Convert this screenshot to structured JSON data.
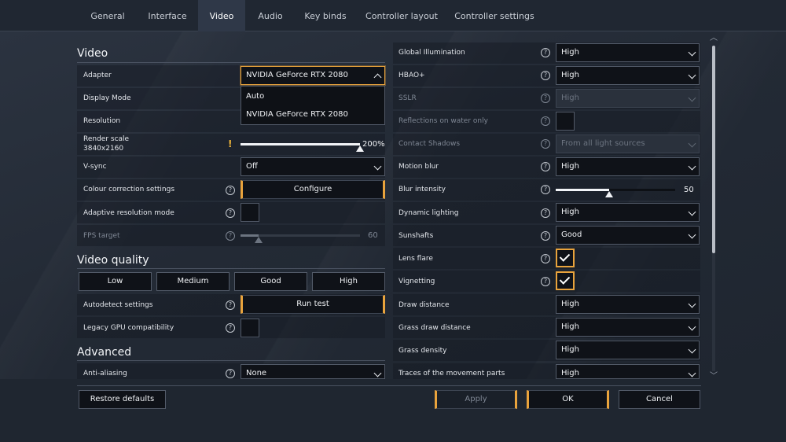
{
  "tabs": [
    "General",
    "Interface",
    "Video",
    "Audio",
    "Key binds",
    "Controller layout",
    "Controller settings"
  ],
  "active_tab": "Video",
  "sections": {
    "video": "Video",
    "quality": "Video quality",
    "advanced": "Advanced"
  },
  "left": {
    "adapter": {
      "label": "Adapter",
      "value": "NVIDIA GeForce RTX 2080",
      "options": [
        "Auto",
        "NVIDIA GeForce RTX 2080"
      ]
    },
    "display_mode": {
      "label": "Display Mode"
    },
    "resolution": {
      "label": "Resolution"
    },
    "render_scale": {
      "label": "Render scale",
      "sub": "3840x2160",
      "value_text": "200%",
      "value": 1.0
    },
    "vsync": {
      "label": "V-sync",
      "value": "Off"
    },
    "colour_correction": {
      "label": "Colour correction settings",
      "button": "Configure"
    },
    "adaptive_res": {
      "label": "Adaptive resolution mode"
    },
    "fps_target": {
      "label": "FPS target",
      "value_text": "60",
      "value": 0.15
    },
    "presets": [
      "Low",
      "Medium",
      "Good",
      "High"
    ],
    "autodetect": {
      "label": "Autodetect settings",
      "button": "Run test"
    },
    "legacy_gpu": {
      "label": "Legacy GPU compatibility"
    },
    "anti_aliasing": {
      "label": "Anti-aliasing",
      "value": "None"
    }
  },
  "right": {
    "global_illumination": {
      "label": "Global Illumination",
      "value": "High"
    },
    "hbao": {
      "label": "HBAO+",
      "value": "High"
    },
    "sslr": {
      "label": "SSLR",
      "value": "High"
    },
    "reflections_water": {
      "label": "Reflections on water only"
    },
    "contact_shadows": {
      "label": "Contact Shadows",
      "value": "From all light sources"
    },
    "motion_blur": {
      "label": "Motion blur",
      "value": "High"
    },
    "blur_intensity": {
      "label": "Blur intensity",
      "value_text": "50",
      "value": 0.45
    },
    "dynamic_lighting": {
      "label": "Dynamic lighting",
      "value": "High"
    },
    "sunshafts": {
      "label": "Sunshafts",
      "value": "Good"
    },
    "lens_flare": {
      "label": "Lens flare",
      "checked": true
    },
    "vignetting": {
      "label": "Vignetting",
      "checked": true
    },
    "draw_distance": {
      "label": "Draw distance",
      "value": "High"
    },
    "grass_draw_distance": {
      "label": "Grass draw distance",
      "value": "High"
    },
    "grass_density": {
      "label": "Grass density",
      "value": "High"
    },
    "movement_traces": {
      "label": "Traces of the movement parts",
      "value": "High"
    }
  },
  "footer": {
    "restore": "Restore defaults",
    "apply": "Apply",
    "ok": "OK",
    "cancel": "Cancel"
  },
  "help_glyph": "?",
  "warn_glyph": "!",
  "colors": {
    "accent": "#e9a33c",
    "panel": "#0f1218",
    "background": "#252c37"
  }
}
